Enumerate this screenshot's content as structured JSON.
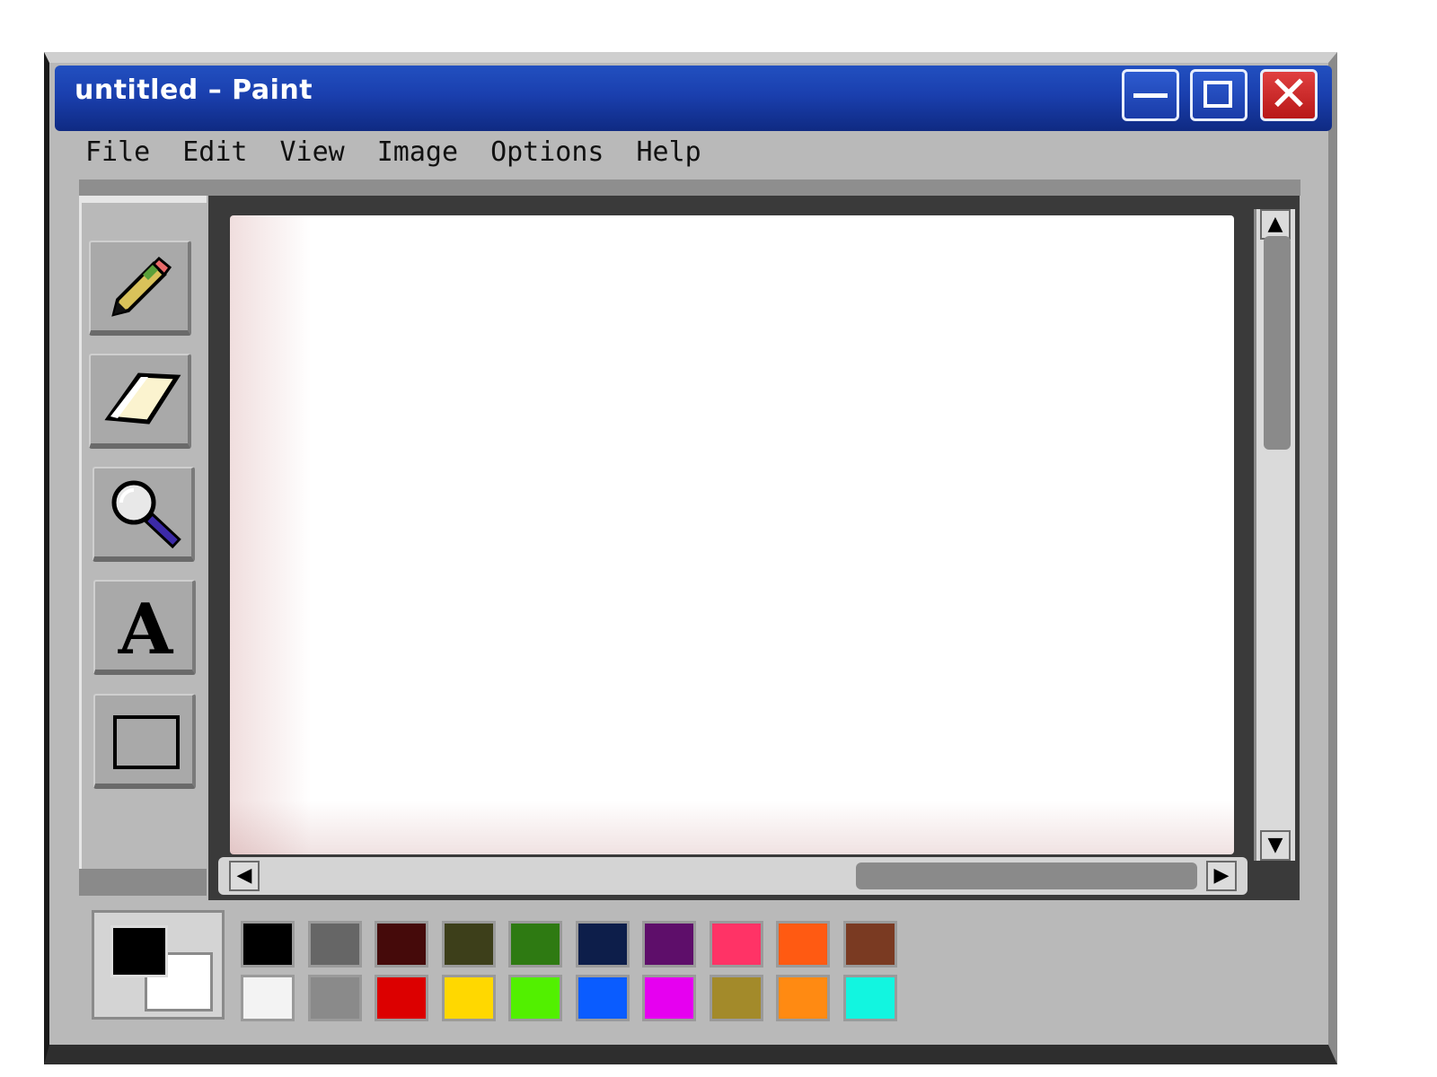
{
  "window": {
    "title": "untitled – Paint",
    "controls": {
      "minimize": "minimize",
      "maximize": "maximize",
      "close": "close"
    }
  },
  "menu": [
    "File",
    "Edit",
    "View",
    "Image",
    "Options",
    "Help"
  ],
  "tools": [
    {
      "name": "pencil-tool",
      "icon": "pencil-icon"
    },
    {
      "name": "eraser-tool",
      "icon": "eraser-icon"
    },
    {
      "name": "magnifier-tool",
      "icon": "magnifier-icon"
    },
    {
      "name": "text-tool",
      "icon": "text-icon",
      "glyph": "A"
    },
    {
      "name": "select-tool",
      "icon": "select-icon"
    }
  ],
  "scrollbars": {
    "up": "▲",
    "down": "▼",
    "left": "◀",
    "right": "▶"
  },
  "colors": {
    "foreground": "#000000",
    "background": "#ffffff",
    "palette_row1": [
      "#000000",
      "#666666",
      "#450a0a",
      "#3d3f1a",
      "#2e7a12",
      "#0d1e4a",
      "#5e0e6a",
      "#ff3366",
      "#ff5a12",
      "#7a3a22"
    ],
    "palette_row2": [
      "#f3f3f3",
      "#8a8a8a",
      "#dc0000",
      "#ffd800",
      "#52f000",
      "#0a5cff",
      "#e600f0",
      "#a38a2a",
      "#ff8a12",
      "#12f5e0"
    ]
  }
}
